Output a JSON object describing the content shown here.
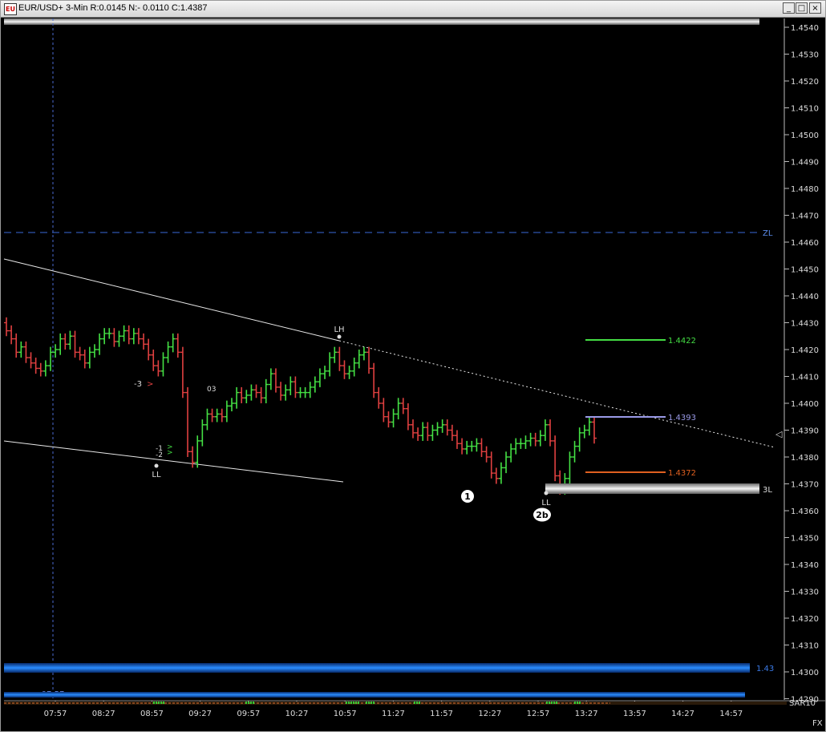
{
  "window": {
    "icon_label": "EU",
    "title": "EUR/USD+ 3-Min R:0.0145 N:- 0.0110 C:1.4387",
    "minimize_glyph": "_",
    "restore_glyph": "□",
    "close_glyph": "×"
  },
  "colors": {
    "background": "#000000",
    "up_bar": "#44e044",
    "down_bar": "#e04040",
    "zl_line": "#3a6ad8",
    "target_green": "#44dd44",
    "target_blue": "#9a9ae8",
    "target_orange": "#e06020"
  },
  "price_axis": {
    "min": 1.4285,
    "max": 1.4545,
    "ticks": [
      "1.4540",
      "1.4530",
      "1.4520",
      "1.4510",
      "1.4500",
      "1.4490",
      "1.4480",
      "1.4470",
      "1.4460",
      "1.4450",
      "1.4440",
      "1.4430",
      "1.4420",
      "1.4410",
      "1.4400",
      "1.4390",
      "1.4380",
      "1.4370",
      "1.4360",
      "1.4350",
      "1.4340",
      "1.4330",
      "1.4320",
      "1.4310",
      "1.4300",
      "1.4290"
    ],
    "current_price_marker": "◁"
  },
  "time_axis": {
    "labels": [
      "07:57",
      "08:27",
      "08:57",
      "09:27",
      "09:57",
      "10:27",
      "10:57",
      "11:27",
      "11:57",
      "12:27",
      "12:57",
      "13:27",
      "13:57",
      "14:27",
      "14:57"
    ],
    "cursor_time": "07:57"
  },
  "levels": {
    "zl": {
      "label": "ZL",
      "price": 1.4462
    },
    "three_l": {
      "label": "3L",
      "price": 1.4366
    },
    "blue_band": {
      "label": "1.43",
      "price": 1.43
    },
    "target_high": {
      "label": "1.4422",
      "price": 1.4422
    },
    "target_mid": {
      "label": "1.4393",
      "price": 1.4393
    },
    "target_low": {
      "label": "1.4372",
      "price": 1.4372
    }
  },
  "annotations": {
    "lh": "LH",
    "ll_first": "LL",
    "ll_second": "LL",
    "wave_one": "1",
    "wave_two_b": "2b",
    "count_minus_three": "-3",
    "count_minus_one": "-1",
    "count_minus_two": "-2",
    "count_zero_three": "03"
  },
  "footer": {
    "indicator_label": "SAR10",
    "corner_label": "FX"
  },
  "chart_data": {
    "type": "ohlc-bar",
    "timeframe": "3-Min",
    "symbol": "EUR/USD+",
    "close": 1.4387,
    "series": [
      {
        "name": "EUR/USD+",
        "values": [
          1.4427,
          1.4424,
          1.4419,
          1.4421,
          1.4417,
          1.4415,
          1.4413,
          1.4412,
          1.4414,
          1.4419,
          1.442,
          1.4424,
          1.4422,
          1.4425,
          1.4419,
          1.4418,
          1.4415,
          1.4419,
          1.442,
          1.4424,
          1.4426,
          1.4426,
          1.4423,
          1.4425,
          1.4427,
          1.4424,
          1.4426,
          1.4424,
          1.4422,
          1.4418,
          1.4414,
          1.4412,
          1.4417,
          1.4421,
          1.4424,
          1.4419,
          1.4404,
          1.4382,
          1.4378,
          1.4386,
          1.4392,
          1.4396,
          1.4395,
          1.4396,
          1.4395,
          1.4399,
          1.44,
          1.4404,
          1.4402,
          1.4403,
          1.4405,
          1.4404,
          1.4402,
          1.4407,
          1.4411,
          1.4406,
          1.4403,
          1.4405,
          1.4408,
          1.4404,
          1.4404,
          1.4404,
          1.4406,
          1.4408,
          1.4411,
          1.4412,
          1.4417,
          1.4419,
          1.4414,
          1.4411,
          1.4412,
          1.4415,
          1.4418,
          1.4419,
          1.4413,
          1.4404,
          1.44,
          1.4395,
          1.4393,
          1.4396,
          1.44,
          1.4398,
          1.4392,
          1.4389,
          1.4388,
          1.4391,
          1.4388,
          1.439,
          1.4391,
          1.4392,
          1.439,
          1.4388,
          1.4385,
          1.4383,
          1.4384,
          1.4384,
          1.4385,
          1.4382,
          1.438,
          1.4374,
          1.4372,
          1.4376,
          1.438,
          1.4383,
          1.4385,
          1.4385,
          1.4386,
          1.4387,
          1.4386,
          1.4388,
          1.4392,
          1.4386,
          1.4373,
          1.4368,
          1.4372,
          1.438,
          1.4384,
          1.4389,
          1.439,
          1.4393,
          1.4387
        ]
      }
    ]
  }
}
